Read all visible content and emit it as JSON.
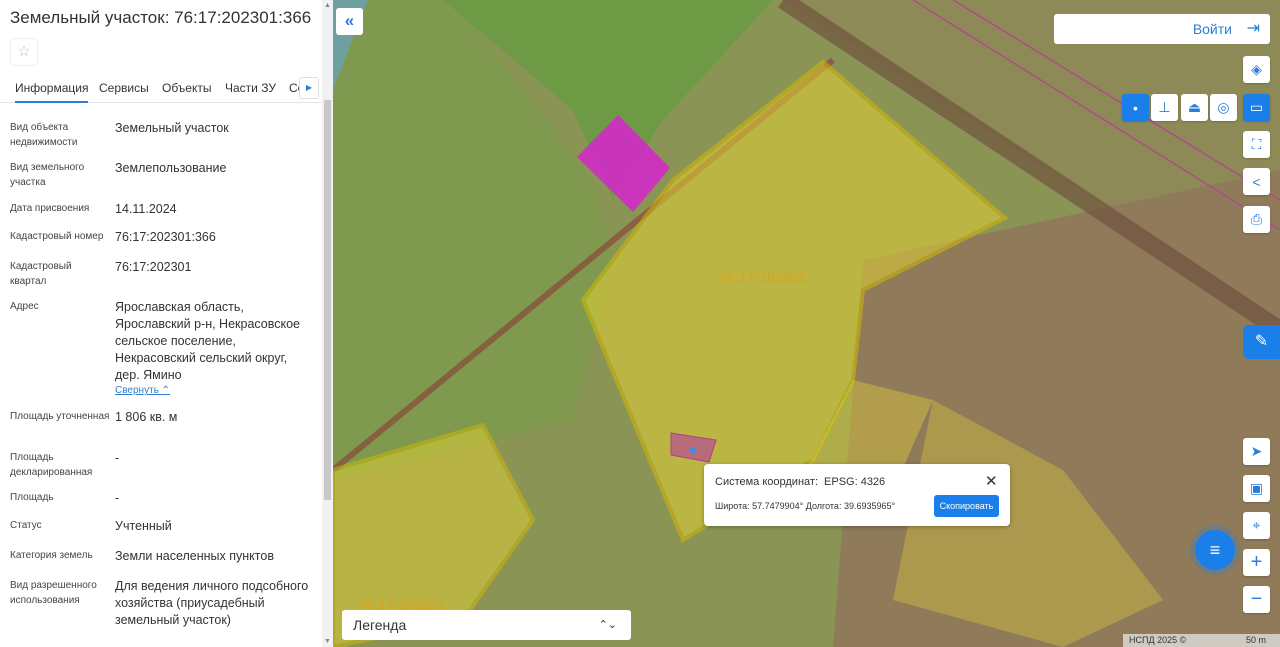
{
  "panel": {
    "title": "Земельный участок: 76:17:202301:366",
    "tabs": [
      "Информация",
      "Сервисы",
      "Объекты",
      "Части ЗУ",
      "Со"
    ],
    "rows": [
      {
        "label": "Вид объекта недвижимости",
        "value": "Земельный участок"
      },
      {
        "label": "Вид земельного участка",
        "value": "Землепользование"
      },
      {
        "label": "Дата присвоения",
        "value": "14.11.2024"
      },
      {
        "label": "Кадастровый номер",
        "value": "76:17:202301:366"
      },
      {
        "label": "Кадастровый квартал",
        "value": "76:17:202301"
      },
      {
        "label": "Адрес",
        "value": "Ярославская область, Ярославский р-н, Некрасовское сельское поселение, Некрасовский сельский округ, дер. Ямино"
      },
      {
        "label": "Площадь уточненная",
        "value": "1 806 кв. м"
      },
      {
        "label": "Площадь декларированная",
        "value": "-"
      },
      {
        "label": "Площадь",
        "value": "-"
      },
      {
        "label": "Статус",
        "value": "Учтенный"
      },
      {
        "label": "Категория земель",
        "value": "Земли населенных пунктов"
      },
      {
        "label": "Вид разрешенного использования",
        "value": "Для ведения личного подсобного хозяйства (приусадебный земельный участок)"
      }
    ],
    "collapse_label": "Свернуть"
  },
  "map": {
    "login_label": "Войти",
    "quarter_labels": [
      "76:17:202301",
      "76:17:202201"
    ],
    "popup": {
      "crs_label": "Система координат:",
      "crs_value": "EPSG: 4326",
      "coords": "Широта: 57.7479904° Долгота: 39.6935965°",
      "copy_label": "Скопировать"
    },
    "legend_label": "Легенда",
    "attribution": "НСПД 2025 ©",
    "scale": "50 m",
    "accent": "#1a7fe8"
  }
}
